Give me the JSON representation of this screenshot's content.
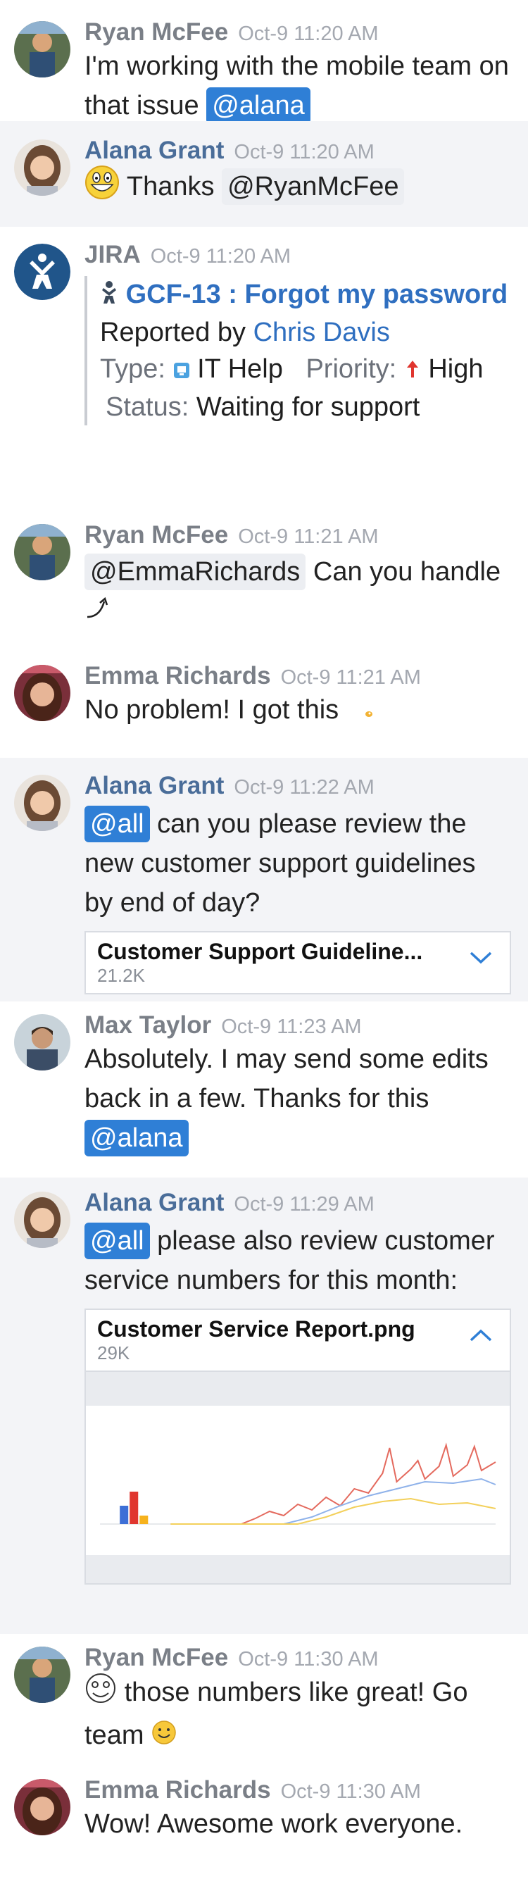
{
  "messages": {
    "m1": {
      "author": "Ryan McFee",
      "time": "Oct-9 11:20 AM",
      "text": "I'm working with the mobile team on that issue",
      "mention": "@alana"
    },
    "m2": {
      "author": "Alana Grant",
      "time": "Oct-9 11:20 AM",
      "text": "Thanks",
      "mention": "@RyanMcFee"
    },
    "m3": {
      "author": "JIRA",
      "time": "Oct-9 11:20 AM",
      "issue_key": "GCF-13 : Forgot my password",
      "reported_by_label": "Reported by",
      "reporter": "Chris Davis",
      "type_label": "Type:",
      "type_value": "IT Help",
      "priority_label": "Priority:",
      "priority_value": "High",
      "status_label": "Status:",
      "status_value": "Waiting for support"
    },
    "m4": {
      "author": "Ryan McFee",
      "time": "Oct-9 11:21 AM",
      "mention": "@EmmaRichards",
      "text": "Can you handle"
    },
    "m5": {
      "author": "Emma Richards",
      "time": "Oct-9 11:21 AM",
      "text": "No problem! I got this"
    },
    "m6": {
      "author": "Alana Grant",
      "time": "Oct-9 11:22 AM",
      "mention": "@all",
      "text": "can you please review the new customer support guidelines by end of day?",
      "attachment_name": "Customer Support Guideline...",
      "attachment_size": "21.2K"
    },
    "m7": {
      "author": "Max Taylor",
      "time": "Oct-9 11:23 AM",
      "text": "Absolutely. I may send some edits back in a few. Thanks for this",
      "mention": "@alana"
    },
    "m8": {
      "author": "Alana Grant",
      "time": "Oct-9 11:29 AM",
      "mention": "@all",
      "text": "please also review customer service numbers for this month:",
      "attachment_name": "Customer Service Report.png",
      "attachment_size": "29K"
    },
    "m9": {
      "author": "Ryan McFee",
      "time": "Oct-9 11:30 AM",
      "text": "those numbers like great! Go team"
    },
    "m10": {
      "author": "Emma Richards",
      "time": "Oct-9 11:30 AM",
      "text": "Wow! Awesome work everyone."
    }
  },
  "colors": {
    "mention_blue": "#2f7fd6",
    "author_blue": "#4a6d99",
    "link_blue": "#2f6fc0",
    "alt_background": "#f3f4f7"
  },
  "icons": [
    "ryan-avatar",
    "alana-avatar",
    "jira-logo",
    "emma-avatar",
    "max-avatar",
    "grin-emoji",
    "rocket-icon",
    "priority-up-arrow-icon",
    "it-help-icon",
    "bug-icon",
    "chevron-down-icon",
    "chevron-up-icon",
    "smile-emoji",
    "rage-face-icon",
    "curved-arrow-icon"
  ]
}
